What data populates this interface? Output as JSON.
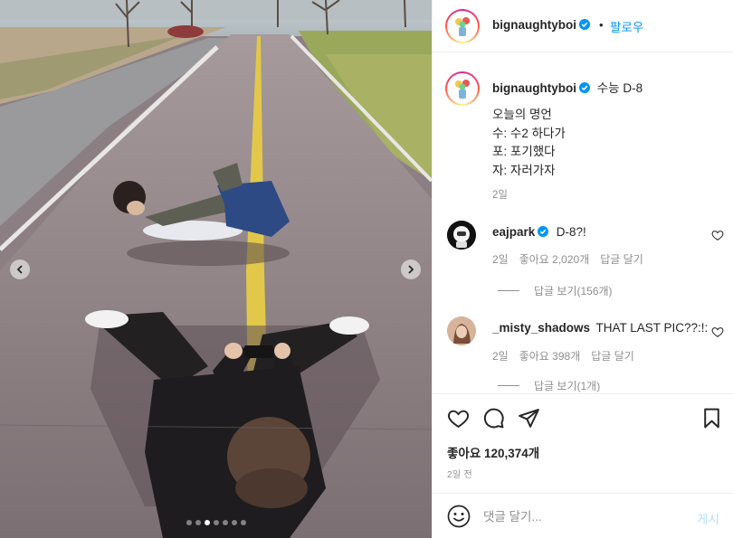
{
  "media": {
    "slide_count": 7,
    "active_slide": 2,
    "prev_icon": "chevron-left-icon",
    "next_icon": "chevron-right-icon"
  },
  "header": {
    "username": "bignaughtyboi",
    "separator": "•",
    "follow_label": "팔로우",
    "verified_color": "#0095f6"
  },
  "caption": {
    "username": "bignaughtyboi",
    "first_line": "수능 D-8",
    "body": "오늘의 명언\n수: 수2 하다가\n포: 포기했다\n자: 자러가자",
    "time": "2일"
  },
  "comments": [
    {
      "username": "eajpark",
      "verified": true,
      "text": "D-8?!",
      "time": "2일",
      "likes": "좋아요 2,020개",
      "reply_label": "답글 달기",
      "view_replies": "답글 보기(156개)"
    },
    {
      "username": "_misty_shadows",
      "verified": false,
      "text": "THAT LAST PIC??:!:",
      "time": "2일",
      "likes": "좋아요 398개",
      "reply_label": "답글 달기",
      "view_replies": "답글 보기(1개)"
    }
  ],
  "actions": {
    "like_icon": "heart-icon",
    "comment_icon": "comment-icon",
    "share_icon": "paper-plane-icon",
    "save_icon": "bookmark-icon",
    "likes_text": "좋아요 120,374개",
    "post_time": "2일 전"
  },
  "composer": {
    "emoji_icon": "smiley-icon",
    "placeholder": "댓글 달기...",
    "post_label": "게시",
    "post_color": "#b2dffc"
  }
}
